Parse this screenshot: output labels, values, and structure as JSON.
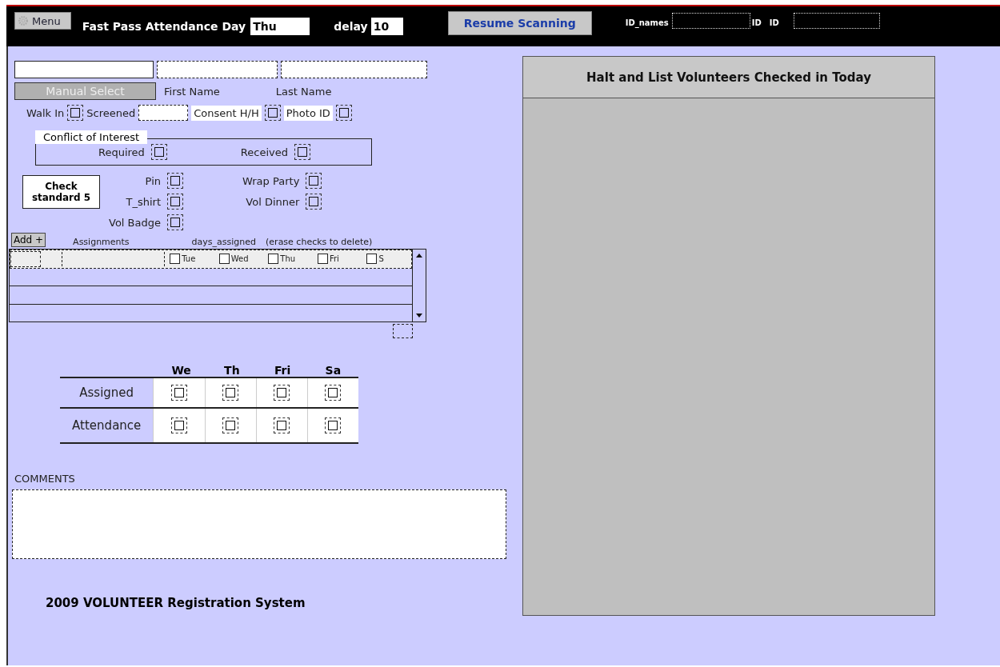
{
  "toolbar": {
    "menu_button": "Menu",
    "title": "Fast Pass Attendance Day",
    "day_field": {
      "value": "Thu"
    },
    "delay_label": "delay",
    "delay_field": {
      "value": "10"
    },
    "resume_button": "Resume Scanning",
    "id_names_label": "ID_names",
    "id_label_1": "ID",
    "id_label_2": "ID"
  },
  "name_row": {
    "manual_select_button": "Manual Select",
    "first_name_label": "First Name",
    "last_name_label": "Last Name"
  },
  "status_row": {
    "walk_in": {
      "label": "Walk In",
      "checked": false
    },
    "screened_label": "Screened",
    "consent": {
      "label": "Consent H/H",
      "checked": false
    },
    "photo_id": {
      "label": "Photo ID",
      "checked": false
    }
  },
  "conflict": {
    "title": "Conflict of Interest",
    "items": [
      {
        "label": "Required",
        "checked": false
      },
      {
        "label": "Received",
        "checked": false
      }
    ]
  },
  "standard": {
    "check_button": "Check standard 5",
    "items_left": [
      {
        "label": "Pin",
        "checked": false
      },
      {
        "label": "T_shirt",
        "checked": false
      },
      {
        "label": "Vol Badge",
        "checked": false
      }
    ],
    "items_right": [
      {
        "label": "Wrap Party",
        "checked": false
      },
      {
        "label": "Vol Dinner",
        "checked": false
      }
    ]
  },
  "assignments": {
    "add_button": "Add +",
    "assignments_label": "Assignments",
    "days_label": "days_assigned",
    "hint": "(erase checks to delete)",
    "days": [
      {
        "label": "Tue",
        "checked": false
      },
      {
        "label": "Wed",
        "checked": false
      },
      {
        "label": "Thu",
        "checked": false
      },
      {
        "label": "Fri",
        "checked": false
      },
      {
        "label": "S",
        "checked": false
      }
    ]
  },
  "attendance": {
    "days": [
      "We",
      "Th",
      "Fri",
      "Sa"
    ],
    "rows": [
      {
        "label": "Assigned",
        "checks": [
          false,
          false,
          false,
          false
        ]
      },
      {
        "label": "Attendance",
        "checks": [
          false,
          false,
          false,
          false
        ]
      }
    ]
  },
  "comments": {
    "label": "COMMENTS"
  },
  "footer": "2009 VOLUNTEER Registration System",
  "panel": {
    "title": "Halt and List Volunteers Checked in Today"
  }
}
